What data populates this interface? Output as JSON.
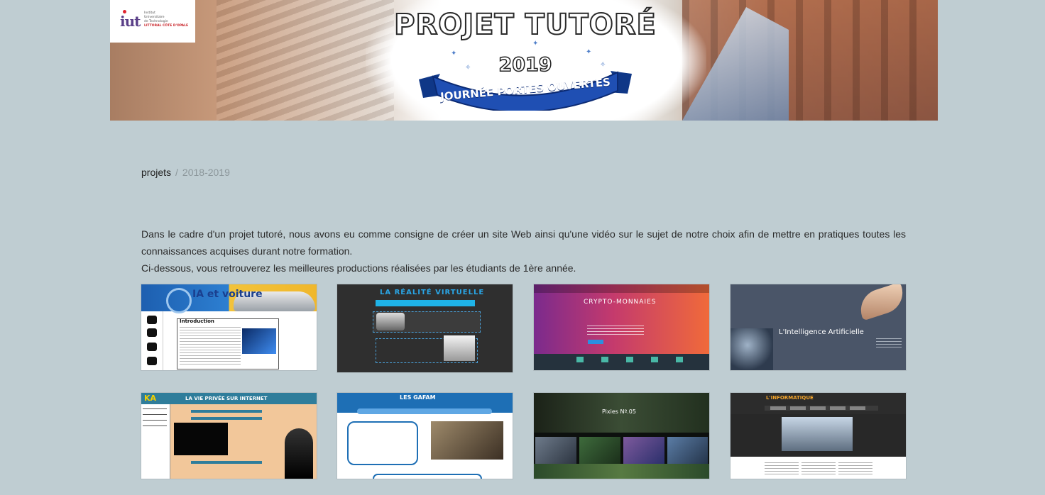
{
  "banner": {
    "logo_mark": "iut",
    "logo_lines": [
      "Institut",
      "Universitaire",
      "de Technologie"
    ],
    "logo_place": "LITTORAL CÔTE D'OPALE",
    "title": "PROJET TUTORÉ",
    "year": "2019",
    "ribbon": "JOURNÉE PORTES OUVERTES"
  },
  "breadcrumb": {
    "parent": "projets",
    "separator": "/",
    "current": "2018-2019"
  },
  "intro": {
    "line1": "Dans le cadre d'un projet tutoré, nous avons eu comme consigne de créer un site Web ainsi qu'une vidéo sur le sujet de notre choix afin de mettre en pratiques toutes les connaissances acquises durant notre formation.",
    "line2": "Ci-dessous, vous retrouverez les meilleures productions réalisées par les étudiants de 1ère année."
  },
  "projects": [
    {
      "title": "IA et voiture",
      "sub": "Introduction"
    },
    {
      "title": "LA RÉALITÉ VIRTUELLE"
    },
    {
      "title": "CRYPTO-MONNAIES"
    },
    {
      "title": "L'Intelligence Artificielle"
    },
    {
      "title": "LA VIE PRIVÉE SUR INTERNET",
      "logo": "KA"
    },
    {
      "title": "LES GAFAM"
    },
    {
      "title": "Pixies Nº.05"
    },
    {
      "title": "L'INFORMATIQUE"
    }
  ]
}
